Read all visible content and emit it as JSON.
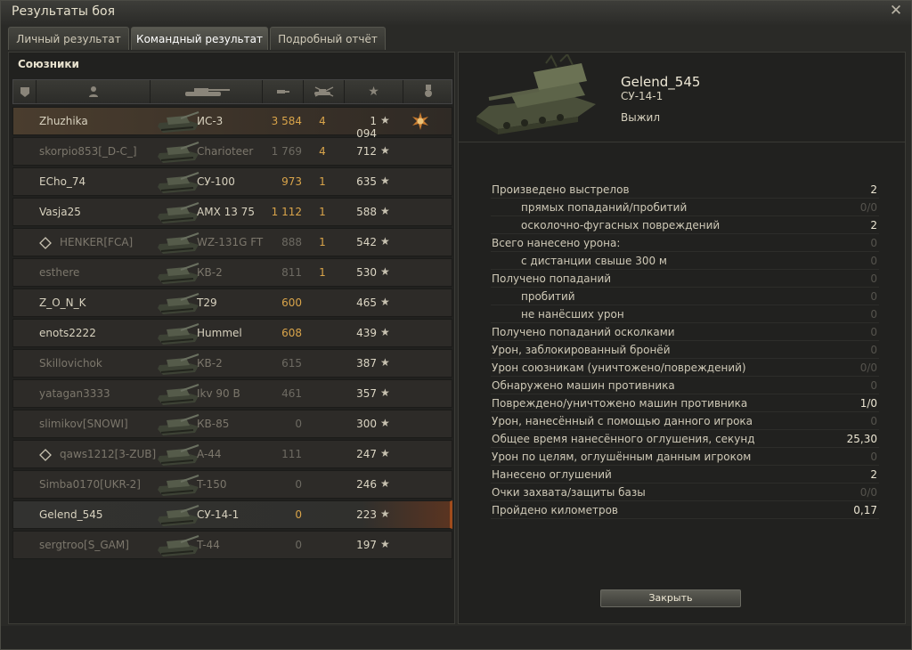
{
  "window": {
    "title": "Результаты боя",
    "close_icon": "close-icon"
  },
  "tabs": [
    {
      "label": "Личный результат",
      "active": false
    },
    {
      "label": "Командный результат",
      "active": true
    },
    {
      "label": "Подробный отчёт",
      "active": false
    }
  ],
  "team": {
    "title": "Союзники",
    "headers": [
      "rank-icon",
      "player-icon",
      "tank-icon",
      "damage-icon",
      "kills-icon",
      "xp-star-icon",
      "medal-icon"
    ],
    "rows": [
      {
        "name": "Zhuzhika",
        "tank": "ИС-3",
        "damage": "3 584",
        "kills": "4",
        "xp": "1 094",
        "icon": "",
        "alive": true,
        "style": "hl",
        "medal": true
      },
      {
        "name": "skorpio853[_D-C_]",
        "tank": "Charioteer",
        "damage": "1 769",
        "kills": "4",
        "xp": "712",
        "icon": "",
        "alive": false,
        "style": "",
        "medal": false
      },
      {
        "name": "ECho_74",
        "tank": "СУ-100",
        "damage": "973",
        "kills": "1",
        "xp": "635",
        "icon": "",
        "alive": true,
        "style": "",
        "medal": false
      },
      {
        "name": "Vasja25",
        "tank": "AMX 13 75",
        "damage": "1 112",
        "kills": "1",
        "xp": "588",
        "icon": "",
        "alive": true,
        "style": "",
        "medal": false
      },
      {
        "name": "HENKER[FCA]",
        "tank": "WZ-131G FT",
        "damage": "888",
        "kills": "1",
        "xp": "542",
        "icon": "squad",
        "alive": false,
        "style": "",
        "medal": false
      },
      {
        "name": "esthere",
        "tank": "КВ-2",
        "damage": "811",
        "kills": "1",
        "xp": "530",
        "icon": "",
        "alive": false,
        "style": "",
        "medal": false
      },
      {
        "name": "Z_O_N_K",
        "tank": "T29",
        "damage": "600",
        "kills": "",
        "xp": "465",
        "icon": "",
        "alive": true,
        "style": "",
        "medal": false
      },
      {
        "name": "enots2222",
        "tank": "Hummel",
        "damage": "608",
        "kills": "",
        "xp": "439",
        "icon": "",
        "alive": true,
        "style": "",
        "medal": false
      },
      {
        "name": "Skillovichok",
        "tank": "КВ-2",
        "damage": "615",
        "kills": "",
        "xp": "387",
        "icon": "",
        "alive": false,
        "style": "",
        "medal": false
      },
      {
        "name": "yatagan3333",
        "tank": "Ikv 90 B",
        "damage": "461",
        "kills": "",
        "xp": "357",
        "icon": "",
        "alive": false,
        "style": "",
        "medal": false
      },
      {
        "name": "slimikov[SNOWI]",
        "tank": "КВ-85",
        "damage": "0",
        "kills": "",
        "xp": "300",
        "icon": "",
        "alive": false,
        "style": "",
        "medal": false
      },
      {
        "name": "qaws1212[3-ZUB]",
        "tank": "A-44",
        "damage": "111",
        "kills": "",
        "xp": "247",
        "icon": "squad",
        "alive": false,
        "style": "",
        "medal": false
      },
      {
        "name": "Simba0170[UKR-2]",
        "tank": "T-150",
        "damage": "0",
        "kills": "",
        "xp": "246",
        "icon": "",
        "alive": false,
        "style": "",
        "medal": false
      },
      {
        "name": "Gelend_545",
        "tank": "СУ-14-1",
        "damage": "0",
        "kills": "",
        "xp": "223",
        "icon": "",
        "alive": true,
        "style": "sel",
        "medal": false
      },
      {
        "name": "sergtroo[S_GAM]",
        "tank": "T-44",
        "damage": "0",
        "kills": "",
        "xp": "197",
        "icon": "",
        "alive": false,
        "style": "",
        "medal": false
      }
    ]
  },
  "detail": {
    "player": "Gelend_545",
    "tank": "СУ-14-1",
    "status": "Выжил",
    "stats": [
      {
        "label": "Произведено выстрелов",
        "value": "2",
        "sub": false,
        "zero": false
      },
      {
        "label": "прямых попаданий/пробитий",
        "value": "0/0",
        "sub": true,
        "zero": true
      },
      {
        "label": "осколочно-фугасных повреждений",
        "value": "2",
        "sub": true,
        "zero": false
      },
      {
        "label": "Всего нанесено урона:",
        "value": "0",
        "sub": false,
        "zero": true
      },
      {
        "label": "с дистанции свыше 300 м",
        "value": "0",
        "sub": true,
        "zero": true
      },
      {
        "label": "Получено попаданий",
        "value": "0",
        "sub": false,
        "zero": true
      },
      {
        "label": "пробитий",
        "value": "0",
        "sub": true,
        "zero": true
      },
      {
        "label": "не нанёсших урон",
        "value": "0",
        "sub": true,
        "zero": true
      },
      {
        "label": "Получено попаданий осколками",
        "value": "0",
        "sub": false,
        "zero": true
      },
      {
        "label": "Урон, заблокированный бронёй",
        "value": "0",
        "sub": false,
        "zero": true
      },
      {
        "label": "Урон союзникам (уничтожено/повреждений)",
        "value": "0/0",
        "sub": false,
        "zero": true
      },
      {
        "label": "Обнаружено машин противника",
        "value": "0",
        "sub": false,
        "zero": true
      },
      {
        "label": "Повреждено/уничтожено машин противника",
        "value": "1/0",
        "sub": false,
        "zero": false
      },
      {
        "label": "Урон, нанесённый с помощью данного игрока",
        "value": "0",
        "sub": false,
        "zero": true
      },
      {
        "label": "Общее время нанесённого оглушения, секунд",
        "value": "25,30",
        "sub": false,
        "zero": false
      },
      {
        "label": "Урон по целям, оглушённым данным игроком",
        "value": "0",
        "sub": false,
        "zero": true
      },
      {
        "label": "Нанесено оглушений",
        "value": "2",
        "sub": false,
        "zero": false
      },
      {
        "label": "Очки захвата/защиты базы",
        "value": "0/0",
        "sub": false,
        "zero": true
      },
      {
        "label": "Пройдено километров",
        "value": "0,17",
        "sub": false,
        "zero": false
      }
    ],
    "close_button": "Закрыть"
  }
}
